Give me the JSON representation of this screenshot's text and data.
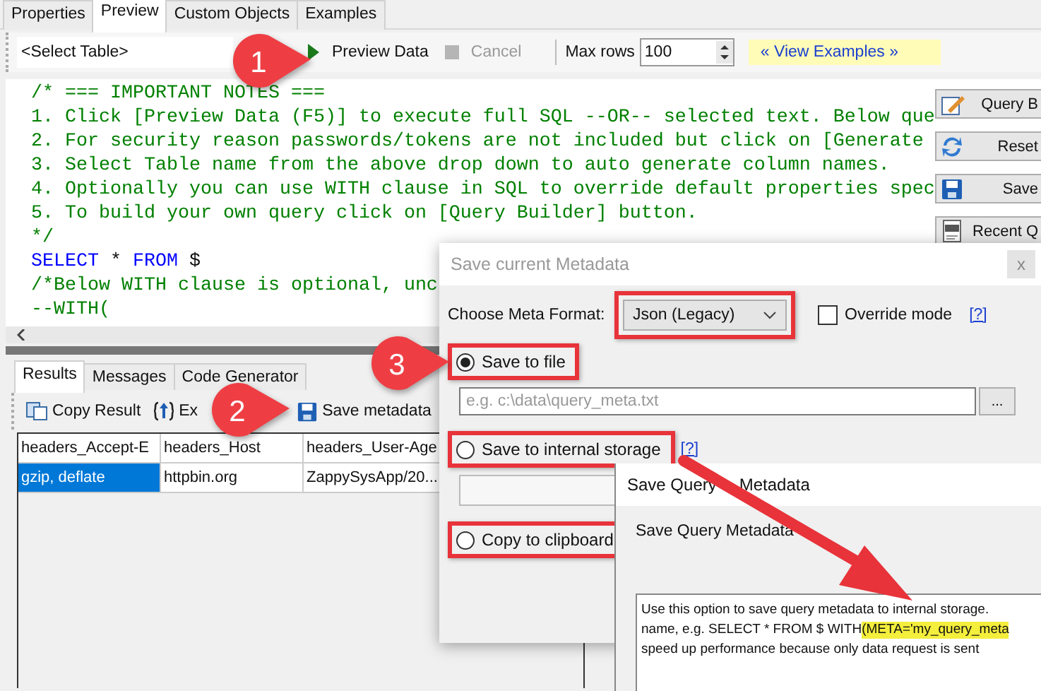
{
  "tabs": [
    {
      "label": "Properties",
      "selected": false
    },
    {
      "label": "Preview",
      "selected": true
    },
    {
      "label": "Custom Objects",
      "selected": false
    },
    {
      "label": "Examples",
      "selected": false
    }
  ],
  "toolbar": {
    "table_select": "<Select Table>",
    "preview_button": {
      "label": "Preview Data",
      "disabled": false
    },
    "cancel_button": {
      "label": "Cancel",
      "disabled": true
    },
    "max_rows_label": "Max rows",
    "max_rows": "100",
    "examples_link": "« View Examples »"
  },
  "editor": {
    "lines": [
      [
        {
          "text": "/* === IMPORTANT NOTES ===",
          "kind": "comment"
        }
      ],
      [
        {
          "text": "1. Click [Preview Data (F5)] to execute full SQL --OR-- selected text. Below que",
          "kind": "comment"
        }
      ],
      [
        {
          "text": "2. For security reason passwords/tokens are not included but click on [Generate",
          "kind": "comment"
        }
      ],
      [
        {
          "text": "3. Select Table name from the above drop down to auto generate column names.",
          "kind": "comment"
        }
      ],
      [
        {
          "text": "4. Optionally you can use WITH clause in SQL to override default properties spec",
          "kind": "comment"
        }
      ],
      [
        {
          "text": "5. To build your own query click on [Query Builder] button.",
          "kind": "comment"
        }
      ],
      [
        {
          "text": "*/",
          "kind": "comment"
        }
      ],
      [
        {
          "text": "SELECT",
          "kind": "keyword"
        },
        {
          "text": " * ",
          "kind": "plain"
        },
        {
          "text": "FROM",
          "kind": "keyword"
        },
        {
          "text": " $",
          "kind": "plain"
        }
      ],
      [
        {
          "text": "/*Below WITH clause is optional, unc",
          "kind": "comment"
        }
      ],
      [
        {
          "text": "--WITH(",
          "kind": "comment"
        }
      ]
    ],
    "side_buttons": [
      {
        "label": "Query B",
        "kind": "builder"
      },
      {
        "label": "Reset",
        "kind": "reset"
      },
      {
        "label": "Save",
        "kind": "save"
      },
      {
        "label": "Recent Q",
        "kind": "recent"
      }
    ]
  },
  "results": {
    "tabs": [
      {
        "label": "Results",
        "selected": true
      },
      {
        "label": "Messages",
        "selected": false
      },
      {
        "label": "Code Generator",
        "selected": false
      }
    ],
    "toolbar": [
      {
        "label": "Copy Result",
        "kind": "copy"
      },
      {
        "label": "Ex",
        "kind": "export"
      },
      {
        "label": "Save metadata",
        "kind": "save"
      }
    ],
    "table": {
      "columns": [
        "headers_Accept-E",
        "headers_Host",
        "headers_User-Age"
      ],
      "rows": [
        {
          "cells": [
            "gzip, deflate",
            "httpbin.org",
            "ZappySysApp/20..."
          ],
          "selected": true
        }
      ]
    }
  },
  "save_dialog": {
    "title": "Save current Metadata",
    "close": "x",
    "format_label": "Choose Meta Format:",
    "format": "Json (Legacy)",
    "override": {
      "label": "Override mode",
      "checked": false
    },
    "help_link": "[?]",
    "options": [
      {
        "label": "Save to file",
        "selected": true,
        "kind": "file",
        "placeholder": "e.g. c:\\data\\query_meta.txt",
        "browse": "..."
      },
      {
        "label": "Save to internal storage",
        "selected": false,
        "kind": "storage",
        "help_link": "[?]"
      },
      {
        "label": "Copy to clipboard",
        "selected": false,
        "kind": "clipboard"
      }
    ]
  },
  "query_dialog": {
    "title_parts": [
      "Save Query",
      "Metadata"
    ],
    "label": "Save Query Metadata",
    "help_lines": [
      {
        "text": "Use this option to save query metadata to internal storage."
      },
      {
        "text": "name, e.g. SELECT * FROM $ WITH",
        "highlight": "(META='my_query_meta"
      },
      {
        "text": "speed up performance because only data request is sent"
      }
    ]
  },
  "annotations": [
    {
      "label": "1"
    },
    {
      "label": "2"
    },
    {
      "label": "3"
    }
  ]
}
